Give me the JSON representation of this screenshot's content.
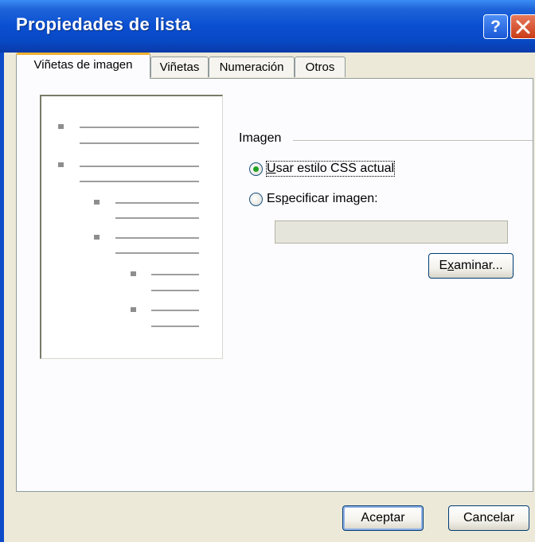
{
  "window": {
    "title": "Propiedades de lista",
    "help_glyph": "?"
  },
  "tabs": [
    {
      "label": "Viñetas de imagen",
      "active": true
    },
    {
      "label": "Viñetas",
      "active": false
    },
    {
      "label": "Numeración",
      "active": false
    },
    {
      "label": "Otros",
      "active": false
    }
  ],
  "image_group": {
    "label": "Imagen",
    "option_css": {
      "label_prefix": "",
      "label_mnemonic": "U",
      "label_rest": "sar estilo CSS actual",
      "selected": true
    },
    "option_specify": {
      "label_prefix": "Es",
      "label_mnemonic": "p",
      "label_rest": "ecificar imagen:",
      "selected": false
    },
    "image_path_value": "",
    "browse": {
      "label_prefix": "E",
      "label_mnemonic": "x",
      "label_rest": "aminar..."
    }
  },
  "footer": {
    "ok_label": "Aceptar",
    "cancel_label": "Cancelar"
  },
  "colors": {
    "title_bar": "#0a4fd2",
    "dialog_bg": "#ece9d8",
    "tab_highlight": "#f0b332",
    "radio_selected": "#21a121"
  }
}
